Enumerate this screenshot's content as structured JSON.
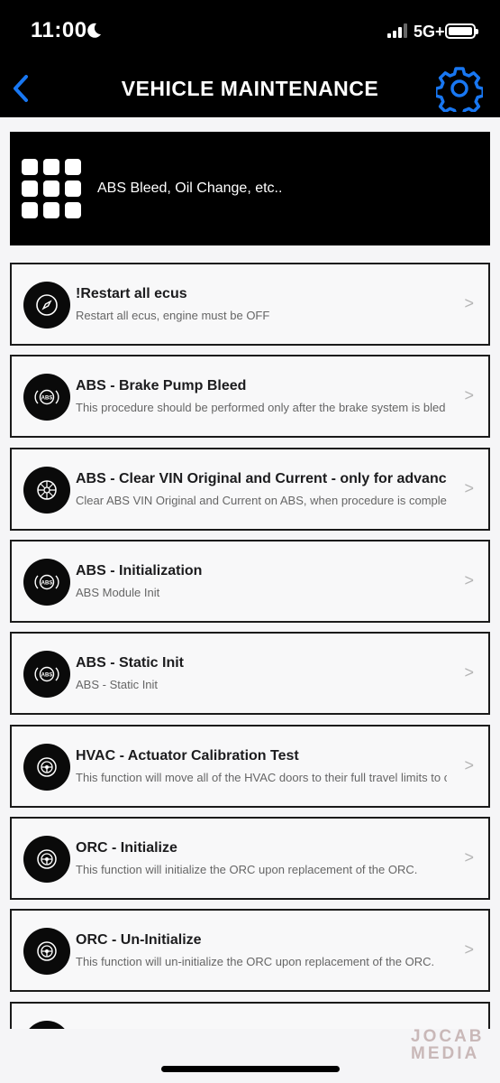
{
  "status_bar": {
    "time": "11:00",
    "network": "5G+",
    "icons": [
      "moon-icon",
      "signal-icon",
      "battery-icon"
    ]
  },
  "nav": {
    "title": "VEHICLE MAINTENANCE",
    "back_icon": "chevron-left-icon",
    "settings_icon": "gear-icon",
    "accent_color": "#1877f2"
  },
  "banner": {
    "icon": "grid-icon",
    "text": "ABS Bleed, Oil Change, etc.."
  },
  "items": [
    {
      "title": "!Restart all ecus",
      "subtitle": "Restart all ecus, engine must be OFF",
      "icon": "compass-icon"
    },
    {
      "title": "ABS - Brake Pump Bleed",
      "subtitle": "This procedure should be performed only after the brake system is bled",
      "icon": "abs-icon"
    },
    {
      "title": "ABS - Clear VIN Original and Current - only for advanced",
      "subtitle": "Clear ABS VIN Original and Current on ABS, when procedure is completed",
      "icon": "wheel-icon"
    },
    {
      "title": "ABS - Initialization",
      "subtitle": "ABS Module Init",
      "icon": "abs-icon"
    },
    {
      "title": "ABS - Static Init",
      "subtitle": "ABS - Static Init",
      "icon": "abs-icon"
    },
    {
      "title": "HVAC - Actuator Calibration Test",
      "subtitle": "This function will move all of the HVAC doors to their full travel limits to calibrate",
      "icon": "steering-wheel-icon"
    },
    {
      "title": "ORC - Initialize",
      "subtitle": "This function will initialize the ORC upon replacement of the ORC.",
      "icon": "steering-wheel-icon"
    },
    {
      "title": "ORC - Un-Initialize",
      "subtitle": "This function will un-initialize the ORC upon replacement of the ORC.",
      "icon": "steering-wheel-icon"
    },
    {
      "title": "",
      "subtitle": "",
      "icon": "steering-wheel-icon"
    }
  ],
  "chevron": ">",
  "watermark": {
    "line1": "JOCAB",
    "line2": "MEDIA"
  }
}
